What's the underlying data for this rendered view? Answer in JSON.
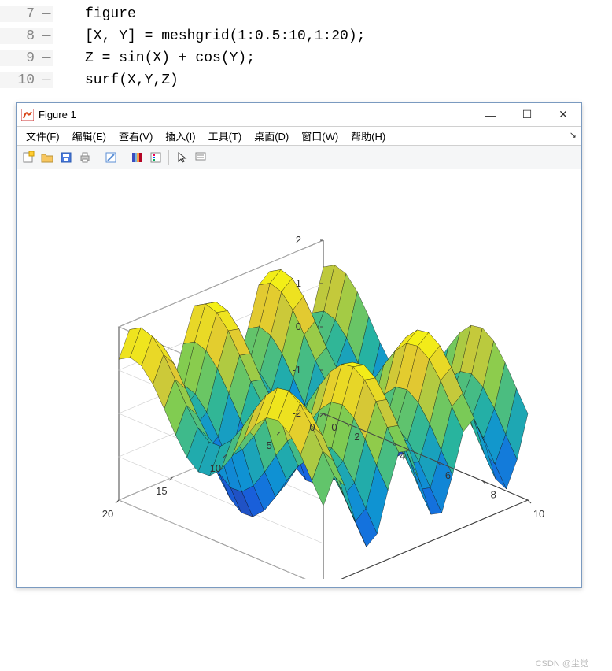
{
  "code": {
    "lines": [
      {
        "num": "7",
        "dash": "—",
        "text": "figure"
      },
      {
        "num": "8",
        "dash": "—",
        "text": "[X, Y] = meshgrid(1:0.5:10,1:20);"
      },
      {
        "num": "9",
        "dash": "—",
        "text": "Z = sin(X) + cos(Y);"
      },
      {
        "num": "10",
        "dash": "—",
        "text": "surf(X,Y,Z)"
      }
    ]
  },
  "window": {
    "title": "Figure 1",
    "menus": [
      "文件(F)",
      "编辑(E)",
      "查看(V)",
      "插入(I)",
      "工具(T)",
      "桌面(D)",
      "窗口(W)",
      "帮助(H)"
    ],
    "toolbar_icons": [
      "new",
      "open",
      "save",
      "print",
      "sep",
      "link",
      "sep",
      "colorbar",
      "legend",
      "sep",
      "pointer",
      "datatip"
    ]
  },
  "chart_data": {
    "type": "surface",
    "title": "",
    "x_range": [
      1,
      10
    ],
    "x_step": 0.5,
    "y_range": [
      1,
      20
    ],
    "y_step": 1,
    "z_formula": "sin(X) + cos(Y)",
    "z_range": [
      -2,
      2
    ],
    "x_ticks": [
      0,
      2,
      4,
      6,
      8,
      10
    ],
    "y_ticks": [
      0,
      5,
      10,
      15,
      20
    ],
    "z_ticks": [
      -2,
      -1,
      0,
      1,
      2
    ],
    "xlabel": "",
    "ylabel": "",
    "zlabel": "",
    "colormap": "parula"
  },
  "watermark": "CSDN @尘觉"
}
